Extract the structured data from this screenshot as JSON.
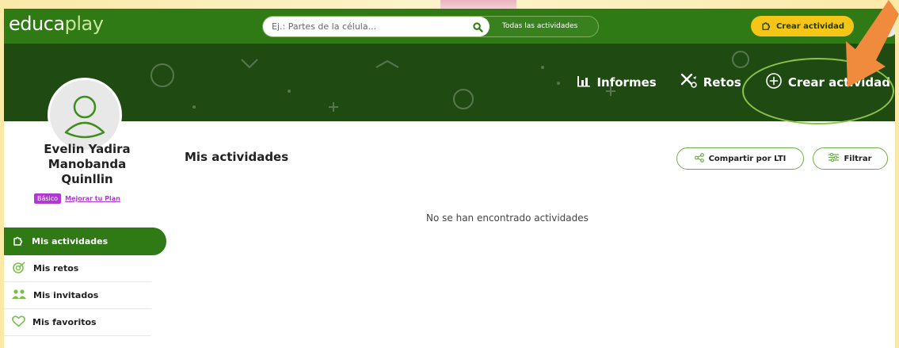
{
  "brand": {
    "logo_edu": "educa",
    "logo_play": "play"
  },
  "search": {
    "placeholder": "Ej.: Partes de la célula...",
    "scope_label": "Todas las actividades"
  },
  "topbar": {
    "create_label": "Crear actividad"
  },
  "banner": {
    "items": [
      {
        "label": "Informes",
        "icon": "bar-chart-icon"
      },
      {
        "label": "Retos",
        "icon": "challenge-icon"
      },
      {
        "label": "Crear actividad",
        "icon": "plus-circle-icon"
      }
    ]
  },
  "user": {
    "name_line1": "Evelin Yadira",
    "name_line2": "Manobanda",
    "name_line3": "Quinllin",
    "plan_badge": "Básico",
    "upgrade_link": "Mejorar tu Plan"
  },
  "sidebar": {
    "items": [
      {
        "label": "Mis actividades",
        "icon": "puzzle-icon",
        "active": true
      },
      {
        "label": "Mis retos",
        "icon": "target-icon",
        "active": false
      },
      {
        "label": "Mis invitados",
        "icon": "people-icon",
        "active": false
      },
      {
        "label": "Mis favoritos",
        "icon": "heart-icon",
        "active": false
      }
    ]
  },
  "main": {
    "title": "Mis actividades",
    "share_label": "Compartir por LTI",
    "filter_label": "Filtrar",
    "empty_message": "No se han encontrado actividades"
  },
  "colors": {
    "primary_green": "#2f7a14",
    "banner_dark": "#1f4a12",
    "accent_yellow": "#f5c518",
    "plan_purple": "#b039d4",
    "annotation_arrow": "#f08a3c",
    "annotation_ellipse": "#8bc34a"
  }
}
